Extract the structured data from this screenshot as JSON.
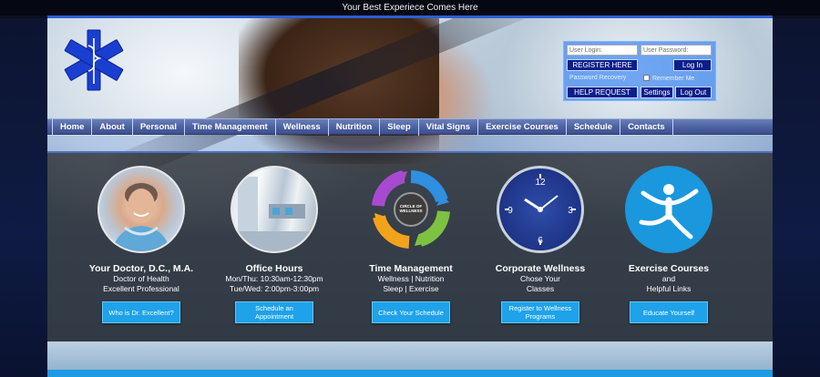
{
  "top": {
    "tagline": "Your Best Experiece Comes Here"
  },
  "login": {
    "user_placeholder": "User Login:",
    "password_placeholder": "User Password:",
    "register": "REGISTER HERE",
    "login_btn": "Log In",
    "password_recovery": "Password Recovery",
    "remember_me": "Remember Me",
    "help": "HELP REQUEST",
    "settings": "Settings",
    "logout": "Log Out"
  },
  "nav": {
    "items": [
      "Home",
      "About",
      "Personal",
      "Time Management",
      "Wellness",
      "Nutrition",
      "Sleep",
      "Vital Signs",
      "Exercise Courses",
      "Schedule",
      "Contacts"
    ]
  },
  "cards": [
    {
      "title": "Your Doctor, D.C., M.A.",
      "lines": [
        "Doctor of Health",
        "Excellent Professional"
      ],
      "button": "Who is Dr. Excellent?"
    },
    {
      "title": "Office Hours",
      "lines": [
        "Mon/Thu:  10:30am-12:30pm",
        "Tue/Wed:  2:00pm-3:00pm"
      ],
      "button": "Schedule an Appointment"
    },
    {
      "title": "Time Management",
      "lines": [
        "Wellness | Nutrition",
        "Sleep | Exercise"
      ],
      "button": "Check Your Schedule",
      "circle_center": "CIRCLE OF WELLNESS"
    },
    {
      "title": "Corporate Wellness",
      "lines": [
        "Chose Your",
        "Classes"
      ],
      "button": "Register to Wellness Programs"
    },
    {
      "title": "Exercise Courses",
      "lines": [
        "and",
        "Helpful Links"
      ],
      "button": "Educate Yourself"
    }
  ],
  "clock_numbers": [
    "12",
    "3",
    "6",
    "9"
  ],
  "colors": {
    "accent": "#1ea2ea",
    "nav": "#4e63a3",
    "dark_button": "#0a1f8a"
  },
  "icons": [
    "star-of-life-icon",
    "person-jumping-icon",
    "clock-icon"
  ]
}
